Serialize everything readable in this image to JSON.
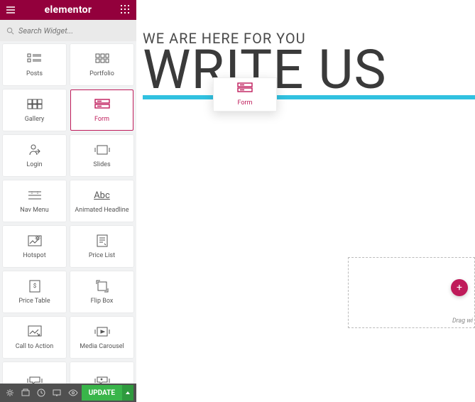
{
  "brand": "elementor",
  "search": {
    "placeholder": "Search Widget..."
  },
  "widgets": [
    {
      "id": "posts",
      "label": "Posts"
    },
    {
      "id": "portfolio",
      "label": "Portfolio"
    },
    {
      "id": "gallery",
      "label": "Gallery"
    },
    {
      "id": "form",
      "label": "Form",
      "active": true
    },
    {
      "id": "login",
      "label": "Login"
    },
    {
      "id": "slides",
      "label": "Slides"
    },
    {
      "id": "nav-menu",
      "label": "Nav Menu"
    },
    {
      "id": "animated-headline",
      "label": "Animated Headline",
      "alt": "Abc"
    },
    {
      "id": "hotspot",
      "label": "Hotspot"
    },
    {
      "id": "price-list",
      "label": "Price List"
    },
    {
      "id": "price-table",
      "label": "Price Table"
    },
    {
      "id": "flip-box",
      "label": "Flip Box"
    },
    {
      "id": "call-to-action",
      "label": "Call to Action"
    },
    {
      "id": "media-carousel",
      "label": "Media Carousel"
    },
    {
      "id": "testimonial",
      "label": ""
    },
    {
      "id": "reviews",
      "label": ""
    }
  ],
  "footer": {
    "update": "UPDATE"
  },
  "hero": {
    "sub": "WE ARE HERE FOR YOU",
    "big": "WRITE US"
  },
  "dragging": {
    "label": "Form"
  },
  "dropzone": {
    "hint": "Drag wi"
  },
  "colors": {
    "brand": "#93003c",
    "accent": "#bf1b5a",
    "cyan": "#31c1e0",
    "green": "#39b54a"
  }
}
